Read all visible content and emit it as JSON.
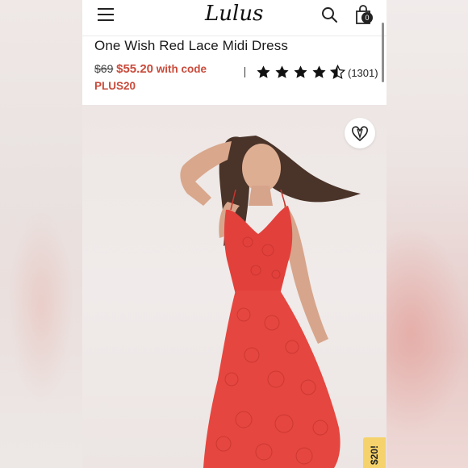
{
  "header": {
    "logo_text": "Lulus",
    "cart_count": "0"
  },
  "product": {
    "title": "One Wish Red Lace Midi Dress",
    "original_price": "$69",
    "sale_price": "$55.20",
    "with_code_text": "with code",
    "promo_code": "PLUS20",
    "rating_stars": 4.5,
    "review_count": "(1301)"
  },
  "promo_tab": {
    "label": "$20!"
  },
  "colors": {
    "accent": "#c94a3a",
    "promo_tab": "#f5d26b",
    "dress": "#e2403b"
  },
  "icons": [
    "menu-icon",
    "search-icon",
    "shopping-bag-icon",
    "star-icon",
    "heart-icon"
  ]
}
